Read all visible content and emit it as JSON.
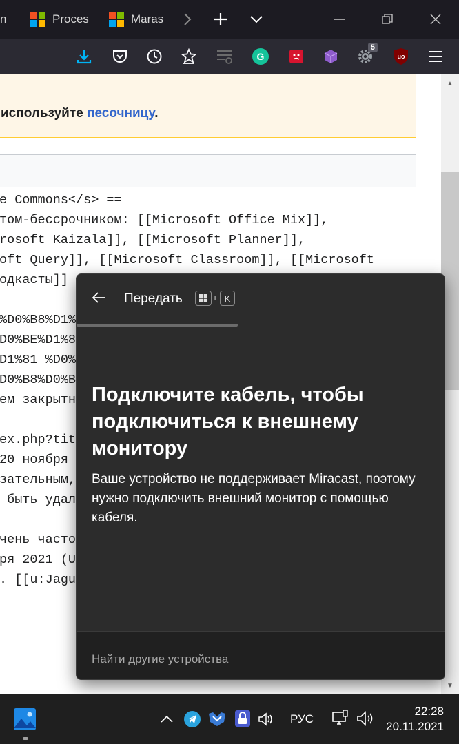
{
  "browser": {
    "tabs": [
      {
        "label": "n"
      },
      {
        "label": "Proces"
      },
      {
        "label": "Maras"
      }
    ],
    "toolbar_icons": [
      "download-icon",
      "pocket-icon",
      "history-icon",
      "bookmarks-icon",
      "reader-icon",
      "grammarly-icon",
      "extension-red-icon",
      "extension-cube-icon",
      "gear-icon",
      "ublock-icon",
      "menu-icon"
    ],
    "extension_badge": "5",
    "accent_color": "#00b3f4"
  },
  "page": {
    "notice": {
      "prefix": "используйте ",
      "link": "песочницу",
      "suffix": "."
    },
    "code_lines": [
      "e Commons</s> ==",
      "том-бессрочником: [[Microsoft Office Mix]],",
      "rosoft Kaizala]], [[Microsoft Planner]],",
      "oft Query]], [[Microsoft Classroom]], [[Microsoft",
      "одкасты]]",
      "",
      "%D0%B8%D1%",
      "D0%BE%D1%8",
      "D1%81_%D0%",
      "D0%B8%D0%B",
      "ем закрытн",
      "",
      "ex.php?tit",
      "20 ноября ",
      "зательным,",
      " быть удал",
      "",
      "чень часто",
      "ря 2021 (U",
      ". [[u:Jagu"
    ]
  },
  "cast_flyout": {
    "title": "Передать",
    "shortcut_key": "K",
    "shortcut_plus": "+",
    "heading": "Подключите кабель, чтобы подключиться к внешнему монитору",
    "body": "Ваше устройство не поддерживает Miracast, поэтому нужно подключить внешний монитор с помощью кабеля.",
    "footer_link": "Найти другие устройства",
    "background": "#2c2c2c"
  },
  "taskbar": {
    "language": "РУС",
    "time": "22:28",
    "date": "20.11.2021"
  }
}
